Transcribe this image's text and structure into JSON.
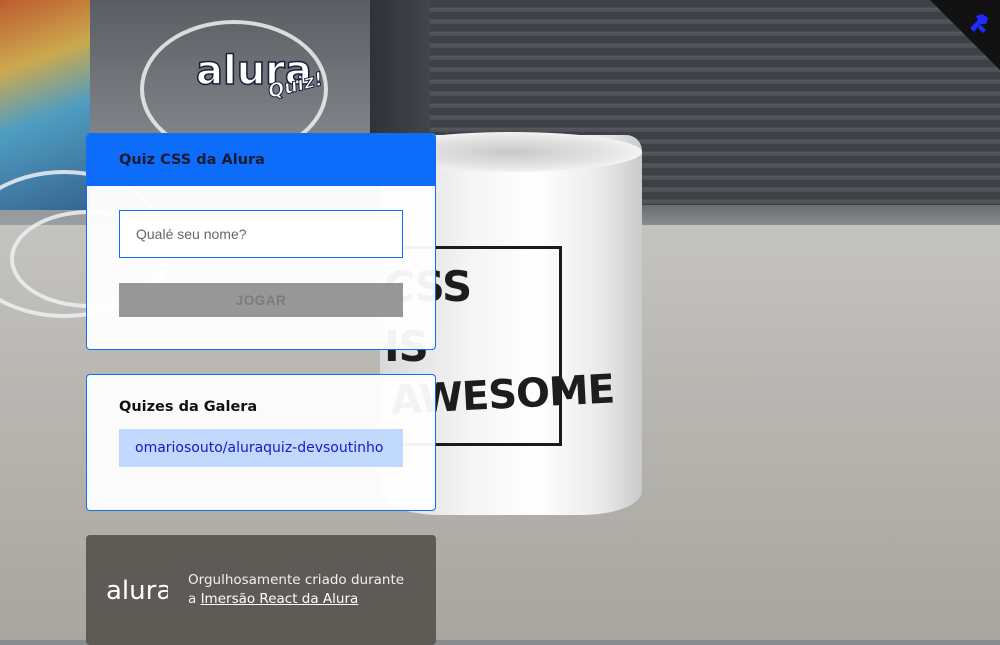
{
  "brand": {
    "logo_text": "alura",
    "logo_sub": "Quiz!"
  },
  "quiz_widget": {
    "title": "Quiz CSS da Alura",
    "name_placeholder": "Qualé seu nome?",
    "name_value": "",
    "play_label": "JOGAR"
  },
  "community_widget": {
    "title": "Quizes da Galera",
    "links": [
      {
        "label": "omariosouto/aluraquiz-devsoutinho"
      }
    ]
  },
  "footer": {
    "logo_text": "alura",
    "text": "Orgulhosamente criado durante a",
    "link_label": "Imersão React da Alura"
  },
  "background_photo": {
    "mug_lines": [
      "CSS",
      "IS",
      "AWESOME"
    ]
  },
  "github_corner": {
    "icon": "github-octocat-icon"
  },
  "colors": {
    "primary": "#0d6dfa",
    "link_bg": "#c1d9fd",
    "link_text": "#1717c8",
    "button_disabled": "#979797",
    "footer_bg": "#5e5a56"
  }
}
